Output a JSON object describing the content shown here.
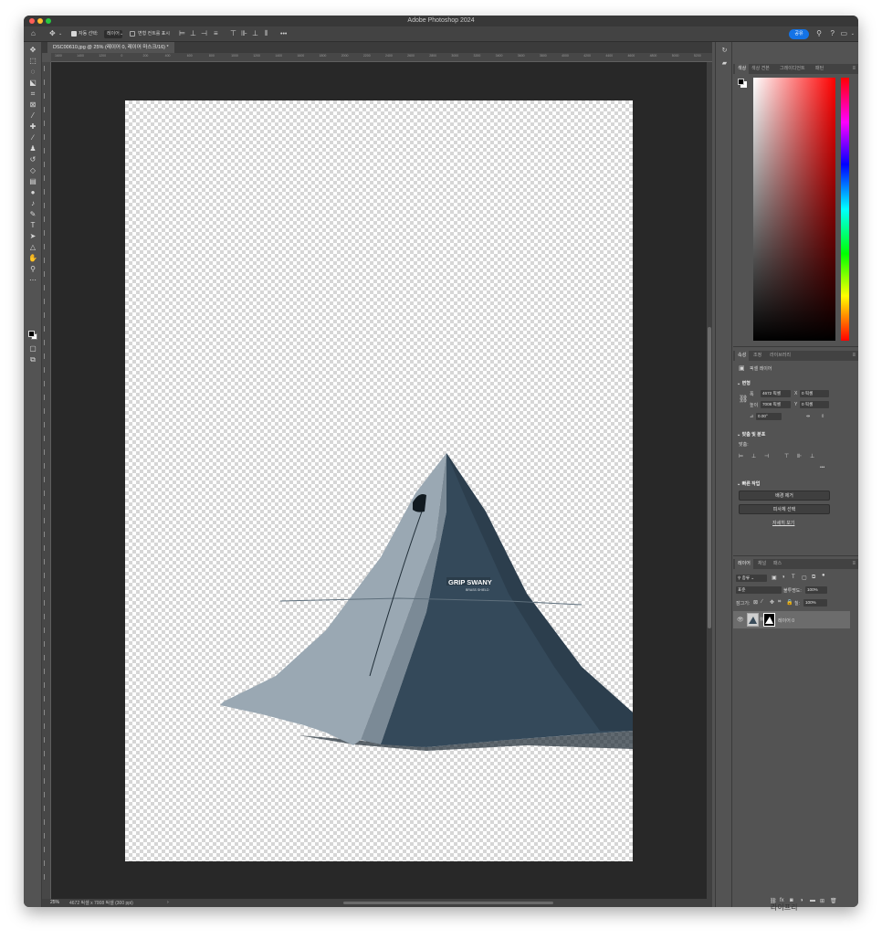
{
  "app_title": "Adobe Photoshop 2024",
  "options_bar": {
    "auto_select_label": "자동 선택:",
    "auto_select_value": "레이어",
    "auto_select_checked": true,
    "show_transform_label": "변형 컨트롤 표시",
    "show_transform_checked": false,
    "more_label": "•••",
    "share_label": "공유"
  },
  "document_tab": {
    "label": "DSC00610.jpg @ 25% (레이어 0, 레이어 마스크/16) *"
  },
  "ruler": {
    "h_ticks": [
      "1600",
      "1400",
      "1200",
      "0",
      "200",
      "400",
      "600",
      "800",
      "1000",
      "1200",
      "1400",
      "1600",
      "1800",
      "2000",
      "2200",
      "2400",
      "2600",
      "2800",
      "3000",
      "3200",
      "3400",
      "3600",
      "3800",
      "4000",
      "4200",
      "4400",
      "4600",
      "4800",
      "5000",
      "5200"
    ]
  },
  "canvas": {
    "tent_brand": "GRIP SWANY",
    "tent_sub": "BRASS SHIELD"
  },
  "status_bar": {
    "zoom": "25%",
    "doc_info": "4672 픽셀 x 7008 픽셀 (300 ppi)",
    "arrow": "›"
  },
  "color_panel": {
    "tabs": [
      "색상",
      "색상 견본",
      "그레이디언트",
      "패턴"
    ],
    "active_tab": "색상",
    "foreground": "#000000",
    "background": "#ffffff"
  },
  "properties_panel": {
    "tabs": [
      "속성",
      "조정",
      "라이브러리"
    ],
    "active_tab": "속성",
    "pixel_layer_label": "픽셀 레이어",
    "transform": {
      "heading": "변형",
      "w_label": "폭",
      "w_value": "4672 픽셀",
      "h_label": "높이",
      "h_value": "7008 픽셀",
      "x_label": "X",
      "x_value": "0 픽셀",
      "y_label": "Y",
      "y_value": "0 픽셀",
      "angle_value": "0.00°"
    },
    "align": {
      "heading": "맞춤 및 분포",
      "sub_label": "맞춤:",
      "more": "•••"
    },
    "quick_actions": {
      "heading": "빠른 작업",
      "remove_bg": "배경 제거",
      "select_subject": "피사체 선택",
      "learn_more": "자세히 보기"
    }
  },
  "layers_panel": {
    "tabs": [
      "레이어",
      "채널",
      "패스"
    ],
    "active_tab": "레이어",
    "filter_label": "종류",
    "blend_mode": "표준",
    "opacity_label": "불투명도:",
    "opacity_value": "100%",
    "lock_label": "잠그기:",
    "fill_label": "칠:",
    "fill_value": "100%",
    "layers": [
      {
        "name": "레이어 0",
        "visible": true
      }
    ]
  },
  "watermark": "라이프리"
}
